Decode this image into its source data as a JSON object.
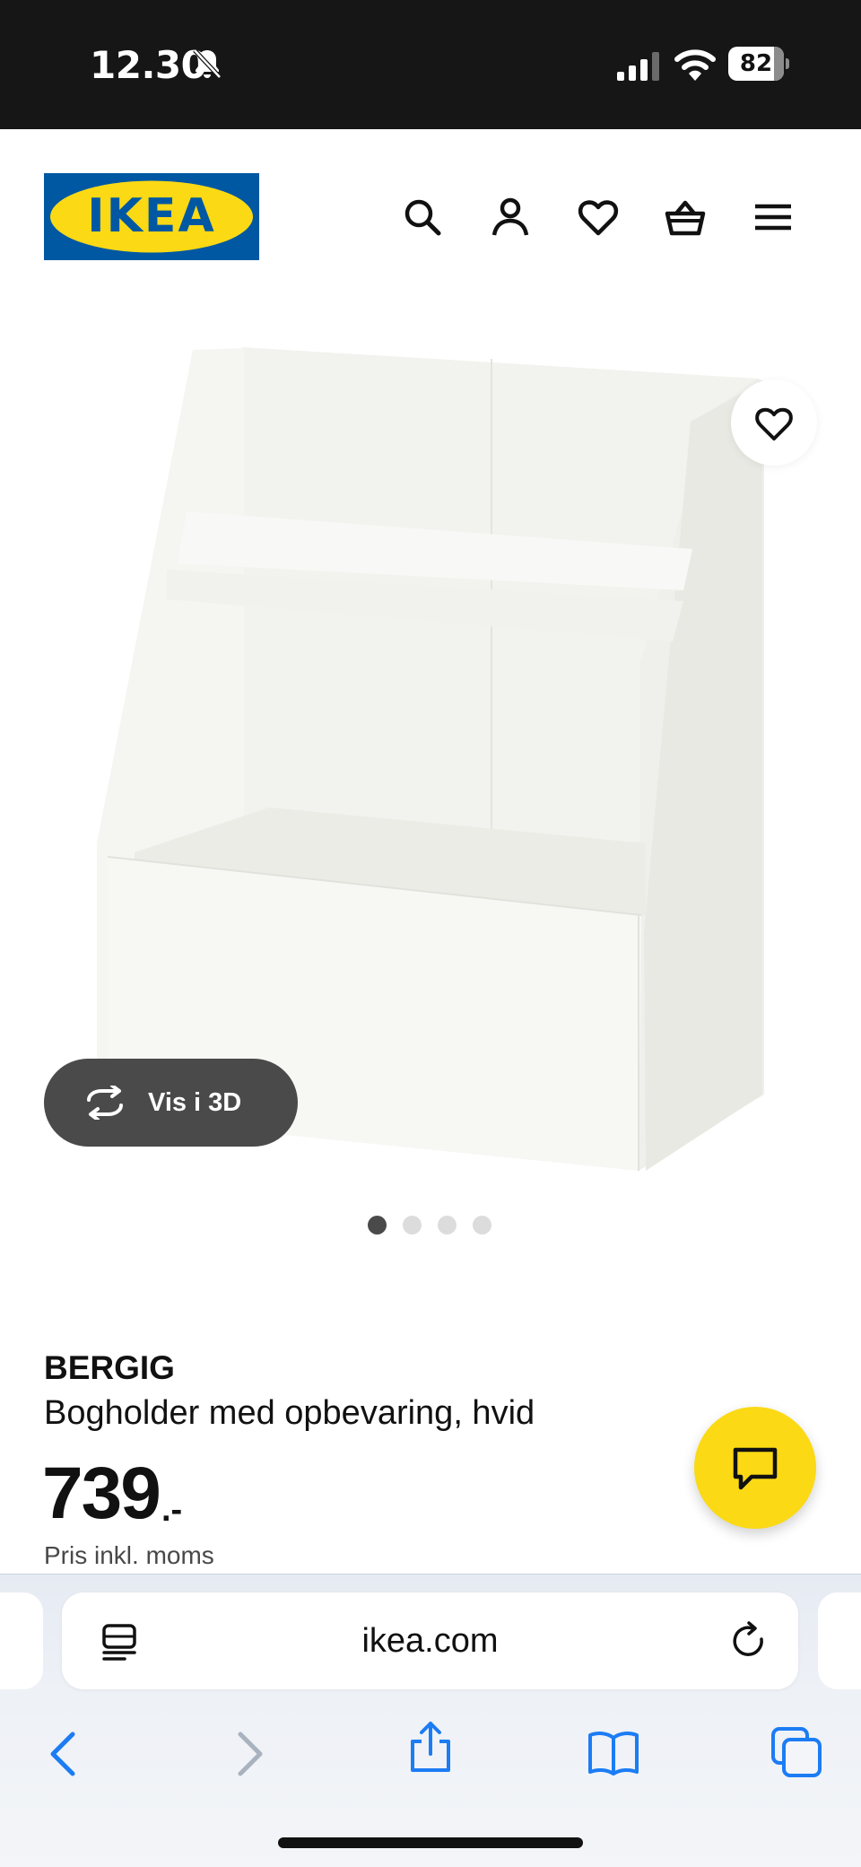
{
  "status_bar": {
    "time": "12.30",
    "battery": "82",
    "battery_level": 0.82,
    "icons": [
      "bell-slash-icon",
      "cellular-signal-icon",
      "wifi-icon",
      "battery-icon"
    ]
  },
  "header": {
    "logo_text": "IKEA",
    "icons": [
      "search-icon",
      "account-icon",
      "wishlist-heart-icon",
      "shopping-basket-icon",
      "hamburger-menu-icon"
    ]
  },
  "gallery": {
    "view3d_label": "Vis i 3D",
    "dots_total": 4,
    "active_dot": 1
  },
  "product": {
    "name": "BERGIG",
    "description": "Bogholder med opbevaring, hvid",
    "price": "739",
    "price_suffix": ".-",
    "price_note": "Pris inkl. moms"
  },
  "browser": {
    "url": "ikea.com",
    "icons": [
      "reader-mode-icon",
      "reload-icon",
      "back-icon",
      "forward-icon",
      "share-icon",
      "bookmarks-icon",
      "tabs-icon"
    ]
  },
  "colors": {
    "ikea_blue": "#0058a3",
    "ikea_yellow": "#fbd914",
    "ios_blue": "#1c7cf4",
    "dark_pill": "#4a4a4a"
  }
}
